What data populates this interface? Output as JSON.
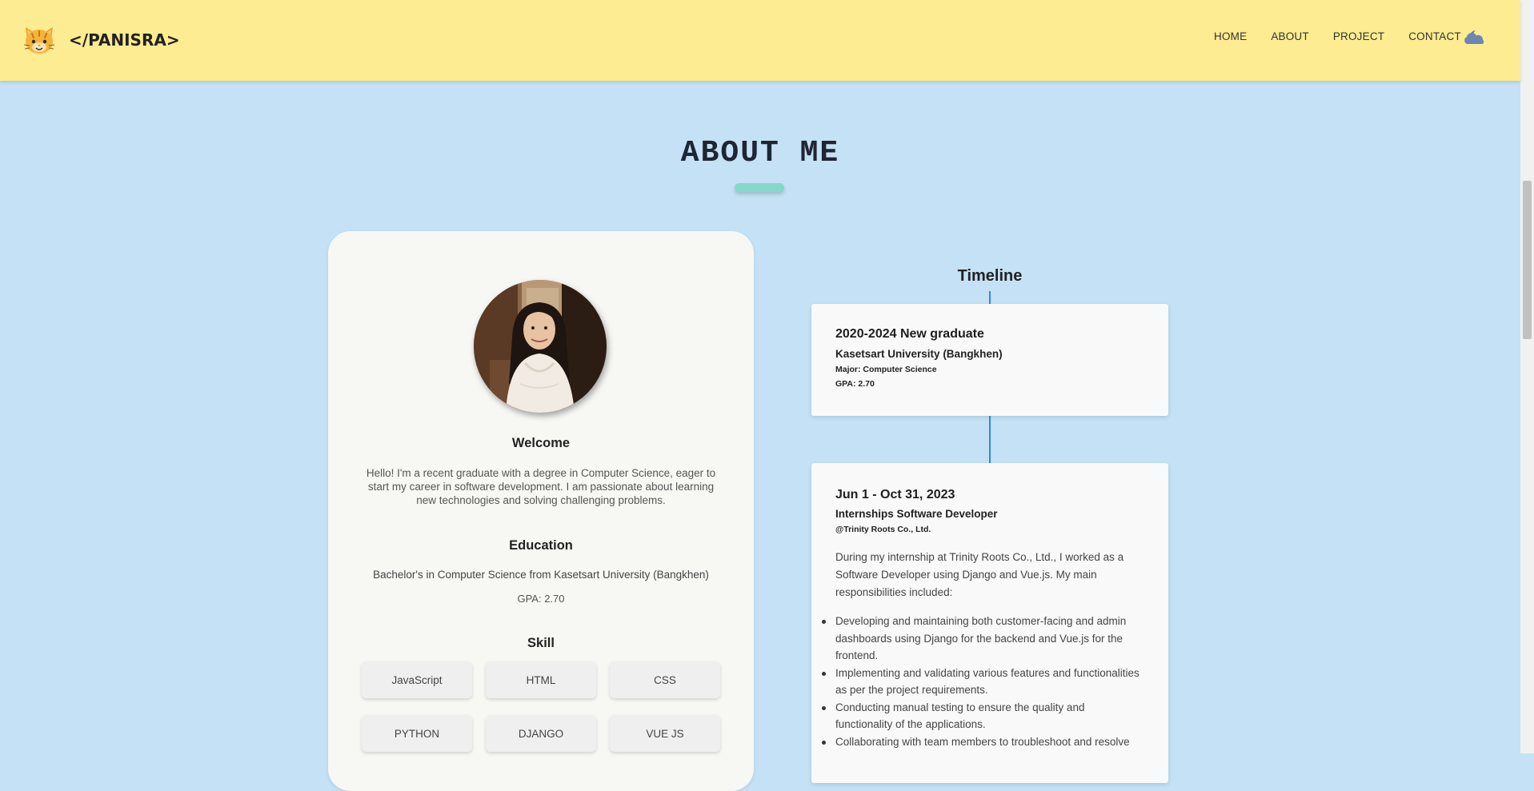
{
  "header": {
    "brand": "</PANISRA>",
    "logo_icon": "cat-face-icon",
    "nav": [
      "HOME",
      "ABOUT",
      "PROJECT",
      "CONTACT"
    ],
    "theme_icon": "cloud-moon-icon"
  },
  "about": {
    "title": "ABOUT ME",
    "accent_color": "#84d9cb"
  },
  "profile": {
    "welcome_title": "Welcome",
    "welcome_text": "Hello! I'm a recent graduate with a degree in Computer Science, eager to start my career in software development. I am passionate about learning new technologies and solving challenging problems.",
    "education_title": "Education",
    "education_text": "Bachelor's in Computer Science from Kasetsart University (Bangkhen)",
    "gpa": "GPA: 2.70",
    "skill_title": "Skill",
    "skills": [
      "JavaScript",
      "HTML",
      "CSS",
      "PYTHON",
      "DJANGO",
      "VUE JS"
    ]
  },
  "timeline": {
    "title": "Timeline",
    "line_color": "#2f87e6",
    "entries": [
      {
        "date": "2020-2024 New graduate",
        "subtitle": "Kasetsart University (Bangkhen)",
        "detail1": "Major: Computer Science",
        "detail2": "GPA: 2.70"
      },
      {
        "date": "Jun 1 - Oct 31, 2023",
        "subtitle": "Internships Software Developer",
        "detail1": "@Trinity Roots Co., Ltd.",
        "intro": "During my internship at Trinity Roots Co., Ltd., I worked as a Software Developer using Django and Vue.js. My main responsibilities included:",
        "bullets": [
          "Developing and maintaining both customer-facing and admin dashboards using Django for the backend and Vue.js for the frontend.",
          "Implementing and validating various features and functionalities as per the project requirements.",
          "Conducting manual testing to ensure the quality and functionality of the applications.",
          "Collaborating with team members to troubleshoot and resolve"
        ]
      }
    ]
  }
}
